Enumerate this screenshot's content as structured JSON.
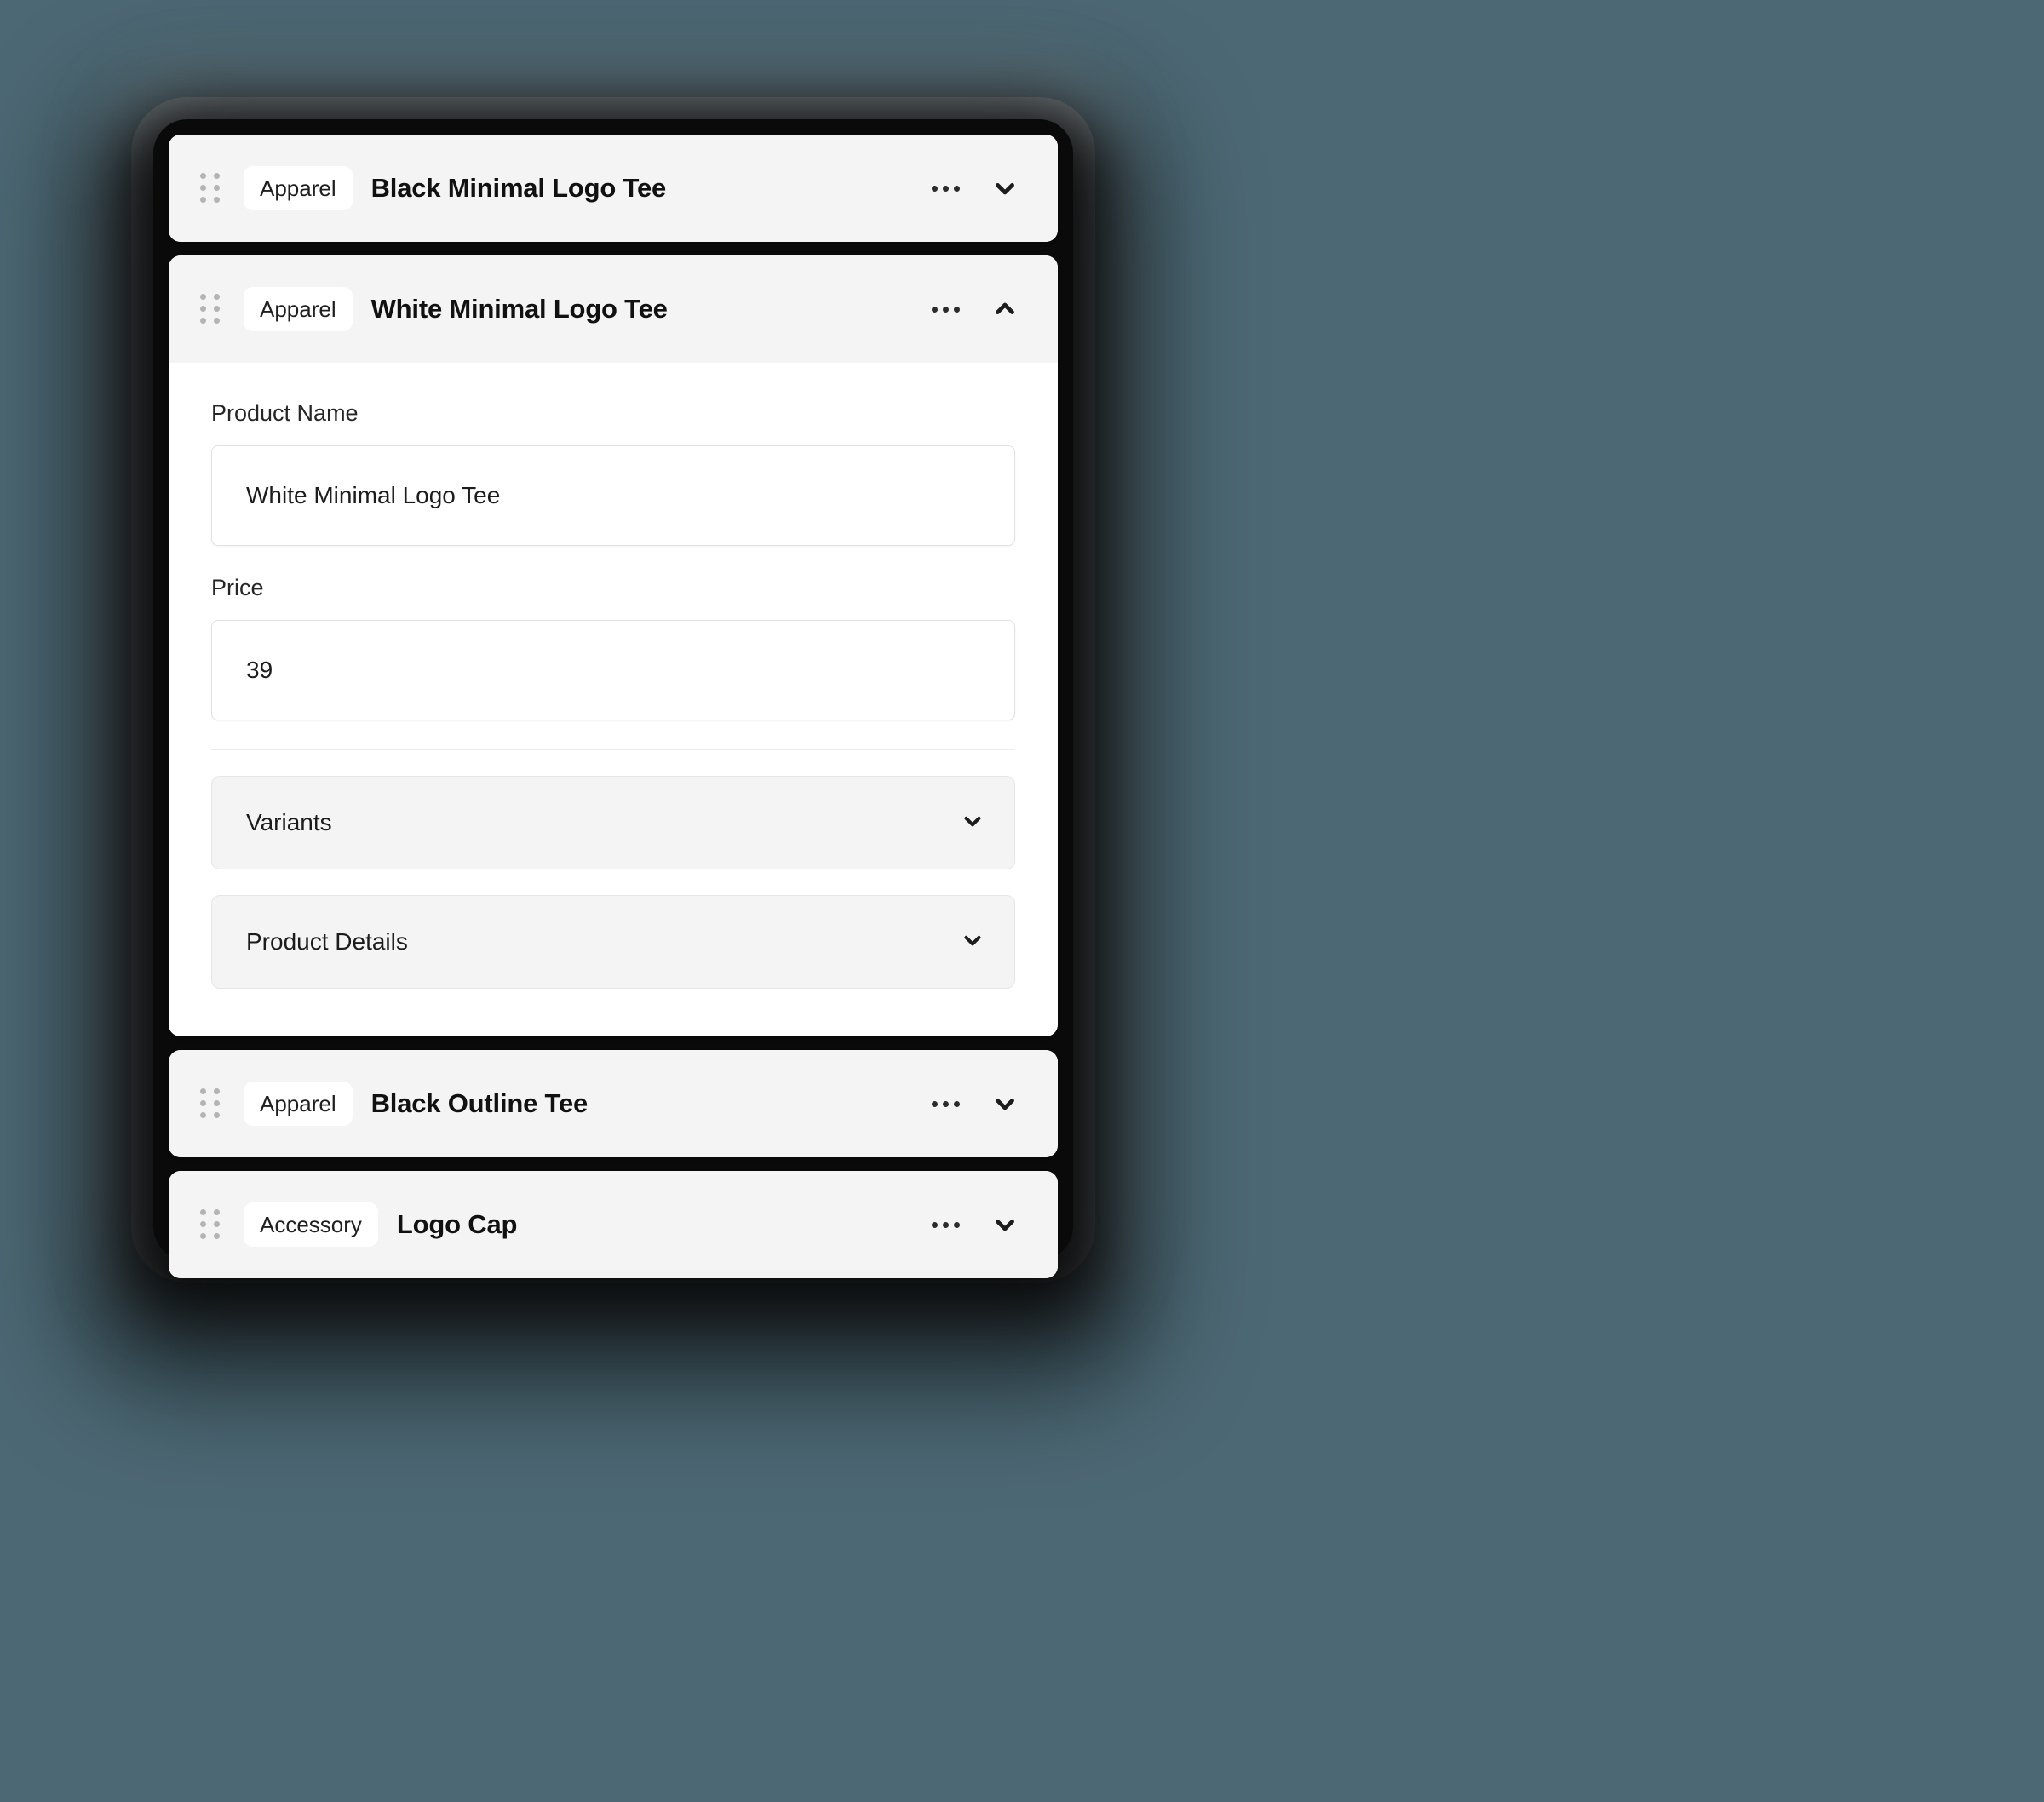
{
  "theme": {
    "page_background": "#4c6874",
    "container_background": "#0a0a0a",
    "card_background": "#f4f4f4",
    "card_expanded_background": "#ffffff",
    "badge_background": "#ffffff",
    "title_color": "#111111",
    "label_color": "#262626",
    "drag_dot_color": "#b4b4b4"
  },
  "icons": {
    "drag_handle": "drag-handle-icon",
    "kebab": "more-options-icon",
    "chevron_down": "chevron-down-icon",
    "chevron_up": "chevron-up-icon"
  },
  "products": [
    {
      "id": "black-minimal-logo-tee",
      "category": "Apparel",
      "title": "Black Minimal Logo Tee",
      "expanded": false
    },
    {
      "id": "white-minimal-logo-tee",
      "category": "Apparel",
      "title": "White Minimal Logo Tee",
      "expanded": true,
      "form": {
        "name_label": "Product Name",
        "name_value": "White Minimal Logo Tee",
        "name_placeholder": "Product Name",
        "price_label": "Price",
        "price_value": "39",
        "price_placeholder": "Price",
        "sections": [
          {
            "label": "Variants",
            "expanded": false
          },
          {
            "label": "Product Details",
            "expanded": false
          }
        ]
      }
    },
    {
      "id": "black-outline-tee",
      "category": "Apparel",
      "title": "Black Outline Tee",
      "expanded": false
    },
    {
      "id": "logo-cap",
      "category": "Accessory",
      "title": "Logo Cap",
      "expanded": false
    }
  ]
}
